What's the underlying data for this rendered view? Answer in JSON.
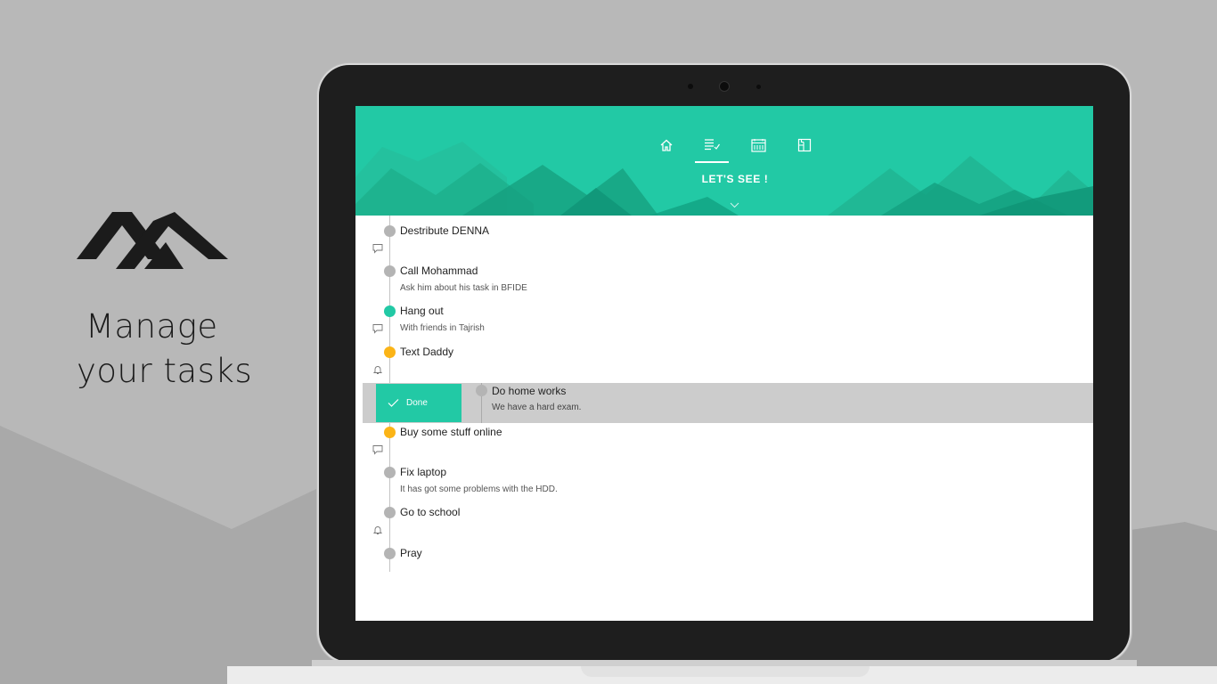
{
  "promo": {
    "line1": "Manage",
    "line2": "your tasks",
    "logo_icon": "mountains-logo"
  },
  "app": {
    "accent_color": "#22c9a5",
    "nav": [
      {
        "name": "home-icon",
        "active": false
      },
      {
        "name": "task-list-icon",
        "active": true
      },
      {
        "name": "calendar-icon",
        "active": false
      },
      {
        "name": "floor-plan-icon",
        "active": false
      }
    ],
    "header_title": "LET'S SEE !",
    "expand_icon": "chevron-down-icon",
    "tasks": [
      {
        "title": "Destribute DENNA",
        "note": "",
        "status": "gray",
        "meta_icon": "comment-icon"
      },
      {
        "title": "Call Mohammad",
        "note": "Ask him about his task in BFIDE",
        "status": "gray",
        "meta_icon": ""
      },
      {
        "title": "Hang out",
        "note": "With friends in Tajrish",
        "status": "green",
        "meta_icon": "comment-icon"
      },
      {
        "title": "Text Daddy",
        "note": "",
        "status": "orange",
        "meta_icon": "bell-icon"
      },
      {
        "title": "Do home works",
        "note": "We have a hard exam.",
        "status": "gray",
        "meta_icon": "",
        "swiped": true,
        "swipe_action": "Done"
      },
      {
        "title": "Buy some stuff online",
        "note": "",
        "status": "orange",
        "meta_icon": "comment-icon"
      },
      {
        "title": "Fix laptop",
        "note": "It has got some problems with the HDD.",
        "status": "gray",
        "meta_icon": ""
      },
      {
        "title": "Go to school",
        "note": "",
        "status": "gray",
        "meta_icon": "bell-icon"
      },
      {
        "title": "Pray",
        "note": "",
        "status": "gray",
        "meta_icon": ""
      }
    ],
    "status_colors": {
      "gray": "#b4b4b4",
      "green": "#22c9a5",
      "orange": "#fbb417"
    }
  }
}
